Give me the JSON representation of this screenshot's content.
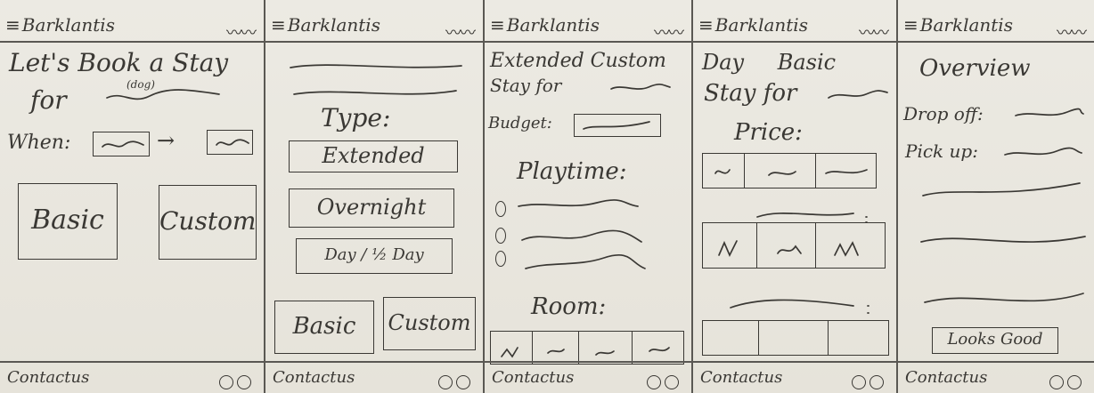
{
  "app": {
    "brand": "Barklantis",
    "menu_icon": "≡",
    "header_wave": "〰〰"
  },
  "footer": {
    "contact": "Contactus"
  },
  "screens": [
    {
      "title_line1": "Let's Book a Stay",
      "title_line2": "for",
      "dog_label": "(dog)",
      "when_label": "When:",
      "arrow": "→",
      "basic_button": "Basic",
      "custom_button": "Custom"
    },
    {
      "type_label": "Type:",
      "options": [
        "Extended",
        "Overnight",
        "Day / ½ Day"
      ],
      "basic_button": "Basic",
      "custom_button": "Custom"
    },
    {
      "title": "Extended Custom",
      "stay_for": "Stay for",
      "budget_label": "Budget:",
      "playtime_label": "Playtime:",
      "room_label": "Room:"
    },
    {
      "title": "Day Basic",
      "stay_for": "Stay for",
      "price_label": "Price:"
    },
    {
      "title": "Overview",
      "dropoff_label": "Drop off:",
      "pickup_label": "Pick up:",
      "confirm_button": "Looks Good"
    }
  ]
}
